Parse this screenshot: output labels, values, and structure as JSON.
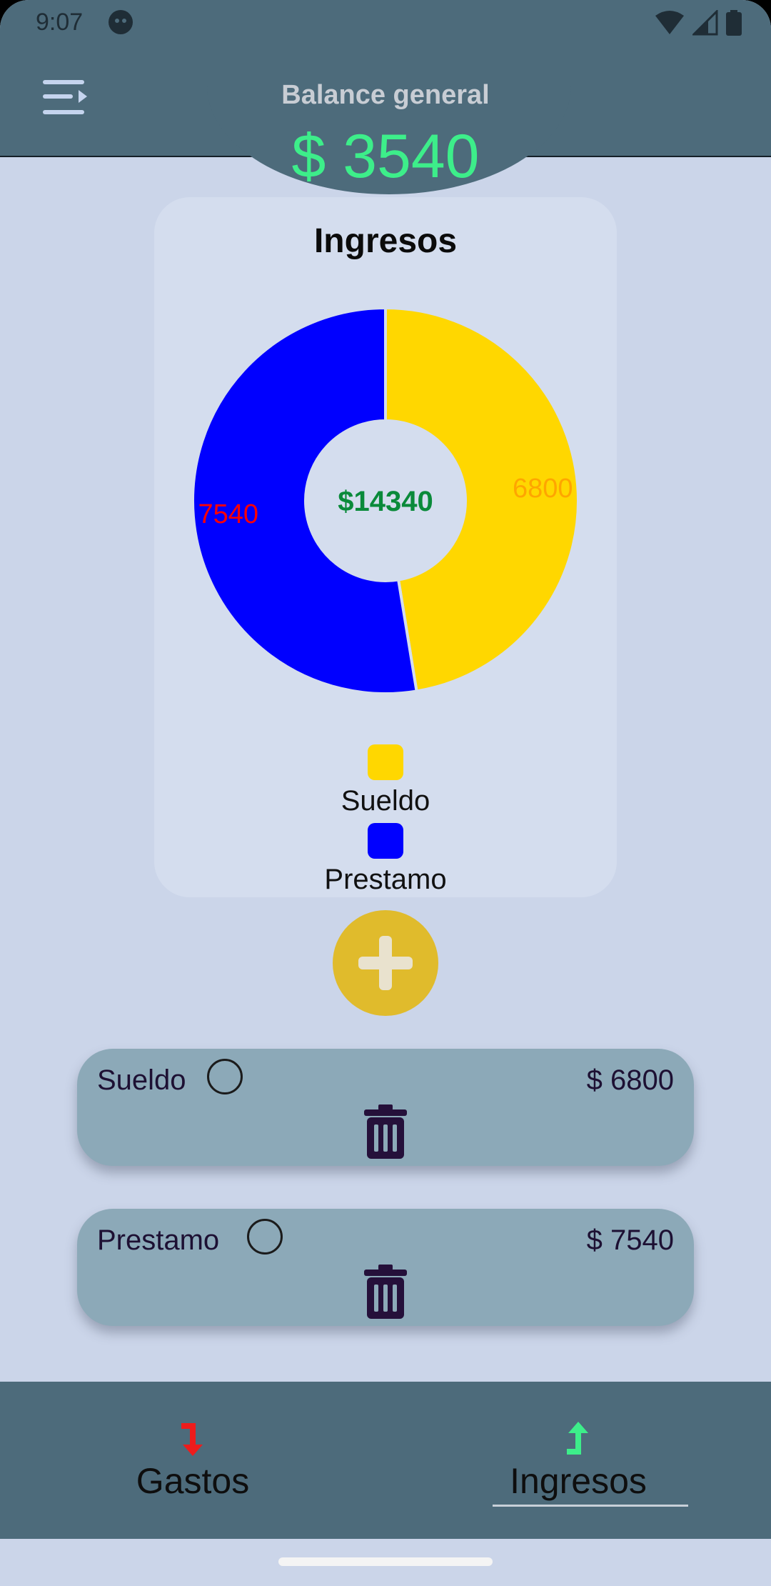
{
  "status_bar": {
    "time": "9:07"
  },
  "header": {
    "title": "Balance general",
    "balance": "$ 3540",
    "accent_color": "#3dee8a",
    "background_color": "#4d6b7b"
  },
  "card": {
    "title": "Ingresos"
  },
  "chart_data": {
    "type": "pie",
    "title": "Ingresos",
    "center_label": "$14340",
    "slices": [
      {
        "label": "Sueldo",
        "value": 6800,
        "value_label": "6800",
        "color": "#ffd700",
        "label_color": "#ffa500"
      },
      {
        "label": "Prestamo",
        "value": 7540,
        "value_label": "7540",
        "color": "#0000ff",
        "label_color": "#ff0000"
      }
    ],
    "legend_position": "bottom"
  },
  "fab": {
    "icon": "plus-icon",
    "color": "#e0bb2c"
  },
  "entries": [
    {
      "name": "Sueldo",
      "amount": "$ 6800",
      "icon": "trash-icon"
    },
    {
      "name": "Prestamo",
      "amount": "$ 7540",
      "icon": "trash-icon"
    }
  ],
  "bottom_nav": {
    "items": [
      {
        "label": "Gastos",
        "icon": "arrow-down-red-icon",
        "color": "#ee1c1c",
        "selected": false
      },
      {
        "label": "Ingresos",
        "icon": "arrow-up-green-icon",
        "color": "#3dee8a",
        "selected": true
      }
    ]
  }
}
